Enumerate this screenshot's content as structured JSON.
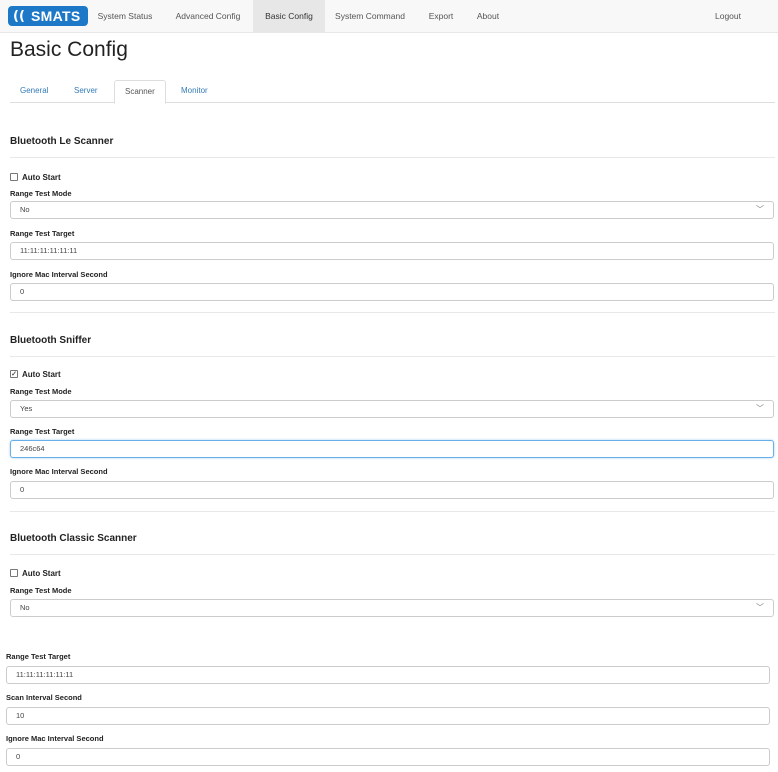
{
  "navbar": {
    "logo_mark": "((",
    "logo_text": "SMATS",
    "items": [
      "System Status",
      "Advanced Config",
      "Basic Config",
      "System Command",
      "Export",
      "About"
    ],
    "logout": "Logout"
  },
  "page_title": "Basic Config",
  "tabs": [
    "General",
    "Server",
    "Scanner",
    "Monitor"
  ],
  "sections": {
    "le": {
      "title": "Bluetooth Le Scanner",
      "auto_start_label": "Auto Start",
      "auto_start_checked": false,
      "range_mode_label": "Range Test Mode",
      "range_mode_value": "No",
      "range_target_label": "Range Test Target",
      "range_target_value": "11:11:11:11:11:11",
      "ignore_label": "Ignore Mac Interval Second",
      "ignore_value": "0"
    },
    "sniffer": {
      "title": "Bluetooth Sniffer",
      "auto_start_label": "Auto Start",
      "auto_start_checked": true,
      "range_mode_label": "Range Test Mode",
      "range_mode_value": "Yes",
      "range_target_label": "Range Test Target",
      "range_target_value": "246c64",
      "ignore_label": "Ignore Mac Interval Second",
      "ignore_value": "0"
    },
    "classic": {
      "title": "Bluetooth Classic Scanner",
      "auto_start_label": "Auto Start",
      "auto_start_checked": false,
      "range_mode_label": "Range Test Mode",
      "range_mode_value": "No",
      "range_target_label": "Range Test Target",
      "range_target_value": "11:11:11:11:11:11",
      "scan_interval_label": "Scan Interval Second",
      "scan_interval_value": "10",
      "ignore_label": "Ignore Mac Interval Second",
      "ignore_value": "0"
    }
  },
  "icons": {
    "checkmark": "✓",
    "chevron": "﹀"
  }
}
